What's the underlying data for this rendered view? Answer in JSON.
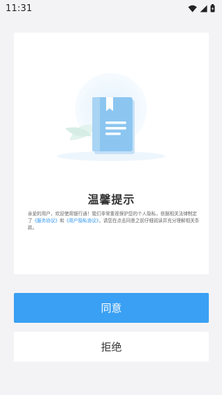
{
  "status_bar": {
    "time": "11:31",
    "icons": [
      "wifi-icon",
      "signal-icon",
      "battery-icon"
    ]
  },
  "dialog": {
    "title": "温馨提示",
    "body_prefix": "亲爱的用户，欢迎使用银行通！我们非常重视保护您的个人隐私，依据相关法律制定了",
    "link_service": "《服务协议》",
    "body_and": "和",
    "link_privacy": "《用户隐私协议》",
    "body_suffix": "，请您在点击同意之前仔细阅读并充分理解相关条款。",
    "illustration_icon": "book-icon"
  },
  "actions": {
    "agree_label": "同意",
    "reject_label": "拒绝"
  },
  "colors": {
    "primary": "#3aa0f3",
    "link": "#2f95ee",
    "background": "#f3f3f5"
  }
}
